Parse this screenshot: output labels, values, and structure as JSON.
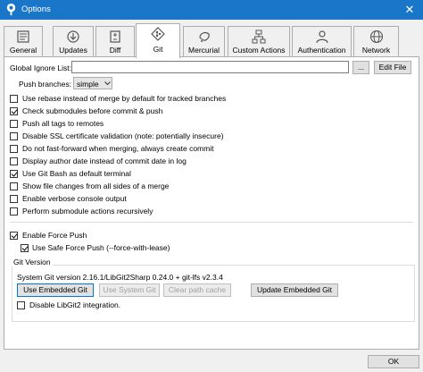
{
  "window": {
    "title": "Options",
    "close_glyph": "✕"
  },
  "tabs": [
    {
      "label": "General",
      "icon": "general-icon"
    },
    {
      "label": "Updates",
      "icon": "updates-icon"
    },
    {
      "label": "Diff",
      "icon": "diff-icon"
    },
    {
      "label": "Git",
      "icon": "git-icon",
      "active": true
    },
    {
      "label": "Mercurial",
      "icon": "mercurial-icon"
    },
    {
      "label": "Custom Actions",
      "icon": "custom-actions-icon"
    },
    {
      "label": "Authentication",
      "icon": "authentication-icon"
    },
    {
      "label": "Network",
      "icon": "network-icon"
    }
  ],
  "git": {
    "ignore_list_label": "Global Ignore List:",
    "ignore_list_value": "",
    "browse_label": "...",
    "edit_file_label": "Edit File",
    "push_branches_label": "Push branches:",
    "push_branches_value": "simple",
    "options": [
      {
        "label": "Use rebase instead of merge by default for tracked branches",
        "checked": false
      },
      {
        "label": "Check submodules before commit & push",
        "checked": true
      },
      {
        "label": "Push all tags to remotes",
        "checked": false
      },
      {
        "label": "Disable SSL certificate validation (note: potentially insecure)",
        "checked": false
      },
      {
        "label": "Do not fast-forward when merging, always create commit",
        "checked": false
      },
      {
        "label": "Display author date instead of commit date in log",
        "checked": false
      },
      {
        "label": "Use Git Bash as default terminal",
        "checked": true
      },
      {
        "label": "Show file changes from all sides of a merge",
        "checked": false
      },
      {
        "label": "Enable verbose console output",
        "checked": false
      },
      {
        "label": "Perform submodule actions recursively",
        "checked": false
      }
    ],
    "force_push": {
      "label": "Enable Force Push",
      "checked": true
    },
    "safe_force_push": {
      "label": "Use Safe Force Push (--force-with-lease)",
      "checked": true
    },
    "version_group": {
      "title": "Git Version",
      "version_text": "System Git version 2.16.1/LibGit2Sharp 0.24.0 + git-lfs v2.3.4",
      "use_embedded_label": "Use Embedded Git",
      "use_system_label": "Use System Git",
      "clear_cache_label": "Clear path cache",
      "update_embedded_label": "Update Embedded Git",
      "disable_libgit2": {
        "label": "Disable LibGit2 integration.",
        "checked": false
      }
    }
  },
  "footer": {
    "ok_label": "OK"
  }
}
